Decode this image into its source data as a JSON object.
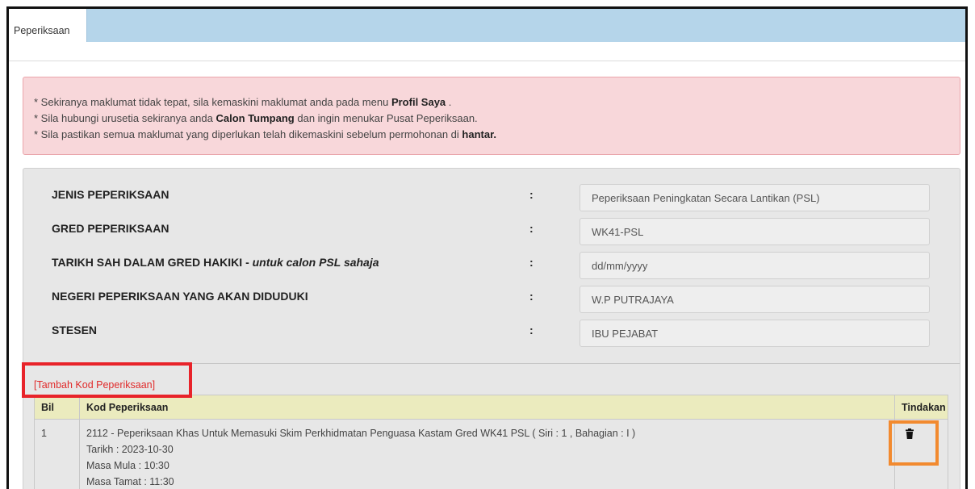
{
  "tabs": [
    {
      "label": "Peperiksaan",
      "active": true
    }
  ],
  "alert": {
    "lines": [
      {
        "text": "* Sekiranya maklumat tidak tepat, sila kemaskini maklumat anda pada menu ",
        "bold": "Profil Saya",
        "after": " ."
      },
      {
        "text": "* Sila hubungi urusetia sekiranya anda ",
        "bold": "Calon Tumpang",
        "after": " dan ingin menukar Pusat Peperiksaan."
      },
      {
        "text": "* Sila pastikan semua maklumat yang diperlukan telah dikemaskini sebelum permohonan di ",
        "bold": "hantar."
      }
    ]
  },
  "form": {
    "separator": ":",
    "fields": [
      {
        "label": "JENIS PEPERIKSAAN",
        "value": "Peperiksaan Peningkatan Secara Lantikan (PSL)"
      },
      {
        "label": "GRED PEPERIKSAAN",
        "value": "WK41-PSL"
      },
      {
        "label": "TARIKH SAH DALAM GRED HAKIKI - ",
        "label_note": "untuk calon PSL sahaja",
        "placeholder": "dd/mm/yyyy"
      },
      {
        "label": "NEGERI PEPERIKSAAN YANG AKAN DIDUDUKI",
        "value": "W.P PUTRAJAYA"
      },
      {
        "label": "STESEN",
        "value": "IBU PEJABAT"
      }
    ]
  },
  "add_exam_code_link": "[Tambah Kod Peperiksaan]",
  "table": {
    "columns": [
      "Bil",
      "Kod Peperiksaan",
      "Tindakan"
    ],
    "rows": [
      {
        "bil": "1",
        "kod": "2112 - Peperiksaan Khas Untuk Memasuki Skim Perkhidmatan Penguasa Kastam Gred WK41 PSL ( Siri : 1 , Bahagian : I )",
        "tarikh": "Tarikh : 2023-10-30",
        "masa_mula": "Masa Mula : 10:30",
        "masa_tamat": "Masa Tamat : 11:30",
        "action_icon": "trash-icon"
      }
    ]
  },
  "colors": {
    "tab_bar": "#b5d5ea",
    "alert_bg": "#f8d7da",
    "alert_border": "#eaa5ab",
    "panel_bg": "#e7e7e7",
    "input_bg": "#eeeeee",
    "table_header_bg": "#ebebbe",
    "link": "#e02b2b",
    "highlight_red": "#e8232a",
    "highlight_orange": "#f28a2f",
    "frame": "#111111"
  }
}
